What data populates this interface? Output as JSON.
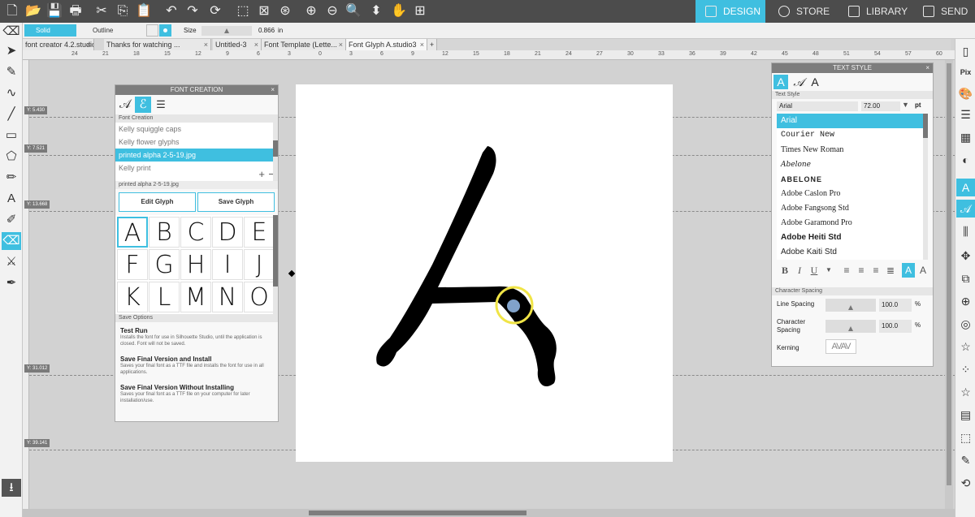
{
  "top_nav": {
    "design": "DESIGN",
    "store": "STORE",
    "library": "LIBRARY",
    "send": "SEND"
  },
  "options_bar": {
    "solid_label": "Solid",
    "outline_label": "Outline",
    "size_label": "Size",
    "size_value": "0.866",
    "size_unit": "in"
  },
  "doc_tabs": [
    "font creator 4.2.studio...",
    "Thanks for watching ...",
    "Untitled-3",
    "Font Template (Lette...",
    "Font Glyph A.studio3"
  ],
  "ruler_labels": [
    "24",
    "21",
    "18",
    "15",
    "12",
    "9",
    "6",
    "3",
    "0",
    "3",
    "6",
    "9",
    "12",
    "15",
    "18",
    "21",
    "24",
    "27",
    "30",
    "33",
    "36",
    "39",
    "42",
    "45",
    "48",
    "51",
    "54",
    "57",
    "60"
  ],
  "guide_labels": [
    "Y: 5.430",
    "Y: 7.521",
    "Y: 13.668",
    "Y: 31.012",
    "Y: 39.141"
  ],
  "font_creation": {
    "title": "FONT CREATION",
    "section": "Font Creation",
    "fonts": [
      "Kelly squiggle caps",
      "Kelly flower glyphs",
      "printed alpha 2-5-19.jpg",
      "Kelly print"
    ],
    "selected_font_index": 2,
    "current_file": "printed alpha 2-5-19.jpg",
    "edit_glyph": "Edit Glyph",
    "save_glyph": "Save Glyph",
    "glyphs": [
      "A",
      "B",
      "C",
      "D",
      "E",
      "F",
      "G",
      "H",
      "I",
      "J",
      "K",
      "L",
      "M",
      "N",
      "O"
    ],
    "save_options_title": "Save Options",
    "options": [
      {
        "title": "Test Run",
        "desc": "Installs the font for use in Silhouette Studio, until the application is closed. Font will not be saved."
      },
      {
        "title": "Save Final Version and Install",
        "desc": "Saves your final font as a TTF file and installs the font for use in all applications."
      },
      {
        "title": "Save Final Version Without Installing",
        "desc": "Saves your final font as a TTF file on your computer for later installation/use."
      }
    ]
  },
  "text_style": {
    "title": "TEXT STYLE",
    "section": "Text Style",
    "font_name": "Arial",
    "font_size": "72.00",
    "size_unit": "pt",
    "fonts": [
      "Arial",
      "Courier New",
      "Times New Roman",
      "Abelone",
      "ABELONE",
      "Adobe Caslon Pro",
      "Adobe Fangsong Std",
      "Adobe Garamond Pro",
      "Adobe Heiti Std",
      "Adobe Kaiti Std"
    ],
    "selected_index": 0,
    "format": {
      "bold": "B",
      "italic": "I",
      "underline": "U"
    },
    "char_spacing_title": "Character Spacing",
    "line_spacing_label": "Line Spacing",
    "line_spacing_value": "100.0",
    "char_spacing_label": "Character Spacing",
    "char_spacing_value": "100.0",
    "percent": "%",
    "kerning_label": "Kerning",
    "kerning_sample": "AVAV"
  },
  "colors": {
    "accent": "#3fbfe0",
    "topbar": "#4c4c4c",
    "canvas": "#d2d2d2"
  }
}
